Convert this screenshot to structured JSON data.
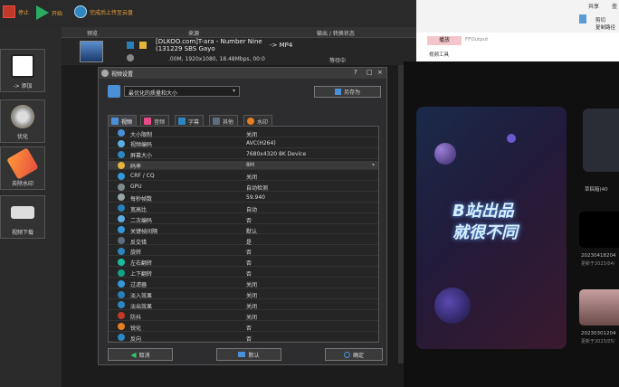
{
  "toolbar": {
    "stop_label": "停止",
    "start_label": "开始",
    "upload_label": "完成后上传至云盘"
  },
  "sidebar": {
    "items": [
      {
        "label": "-> 添加",
        "icon": "add-file-icon"
      },
      {
        "label": "优化",
        "icon": "optimize-gear-icon"
      },
      {
        "label": "去除水印",
        "icon": "eraser-icon"
      },
      {
        "label": "视频下载",
        "icon": "download-icon"
      }
    ]
  },
  "list": {
    "col_preview": "预览",
    "col_source": "来源",
    "col_status": "输出 / 转换状态",
    "file_name": "[DLKOO.com]T-ara - Number Nine (131229 SBS Gayo",
    "target": "-> MP4",
    "file_info": ".00M, 1920x1080, 18.48Mbps, 00:0",
    "status": "等待中"
  },
  "explorer": {
    "tab_share": "共享",
    "tab_view": "查",
    "clip_label": "剪切",
    "copy_path_label": "复制路径",
    "ppt_tab_playback": "播放",
    "ppt_tab_video_tools": "视频工具",
    "ppt_output_name": "FFOutput"
  },
  "dialog": {
    "title": "视频设置",
    "preset_value": "最优化的质量和大小",
    "saveas_label": "另存为",
    "tabs": [
      "视频",
      "音频",
      "字幕",
      "其他",
      "水印"
    ],
    "rows": [
      {
        "name": "大小限制",
        "value": "关闭"
      },
      {
        "name": "视频编码",
        "value": "AVC(H264)"
      },
      {
        "name": "屏幕大小",
        "value": "7680x4320 8K Device"
      },
      {
        "name": "码率",
        "value": "8M",
        "dropdown": "true"
      },
      {
        "name": "CRF / CQ",
        "value": "关闭"
      },
      {
        "name": "GPU",
        "value": "自动检测"
      },
      {
        "name": "每秒帧数",
        "value": "59.940"
      },
      {
        "name": "宽高比",
        "value": "自动"
      },
      {
        "name": "二次编码",
        "value": "否"
      },
      {
        "name": "关键帧间隔",
        "value": "默认"
      },
      {
        "name": "反交错",
        "value": "是"
      },
      {
        "name": "旋转",
        "value": "否"
      },
      {
        "name": "左右翻转",
        "value": "否"
      },
      {
        "name": "上下翻转",
        "value": "否"
      },
      {
        "name": "过滤器",
        "value": "关闭"
      },
      {
        "name": "淡入效果",
        "value": "关闭"
      },
      {
        "name": "淡出效果",
        "value": "关闭"
      },
      {
        "name": "防抖",
        "value": "关闭"
      },
      {
        "name": "锐化",
        "value": "否"
      },
      {
        "name": "反向",
        "value": "否"
      }
    ],
    "cancel_label": "取消",
    "default_label": "默认",
    "ok_label": "确定"
  },
  "video_panel": {
    "banner_line1": "B站出品",
    "banner_line2": "就很不同",
    "side_label": "草稿箱(40",
    "item1_date": "20230418204",
    "item1_sub": "更新于2023/04/",
    "item2_date": "20230301204",
    "item2_sub": "更新于2023/05/"
  },
  "colors": {
    "accent_orange": "#e8a23a",
    "stop_red": "#c0392b",
    "start_green": "#27ae60"
  }
}
